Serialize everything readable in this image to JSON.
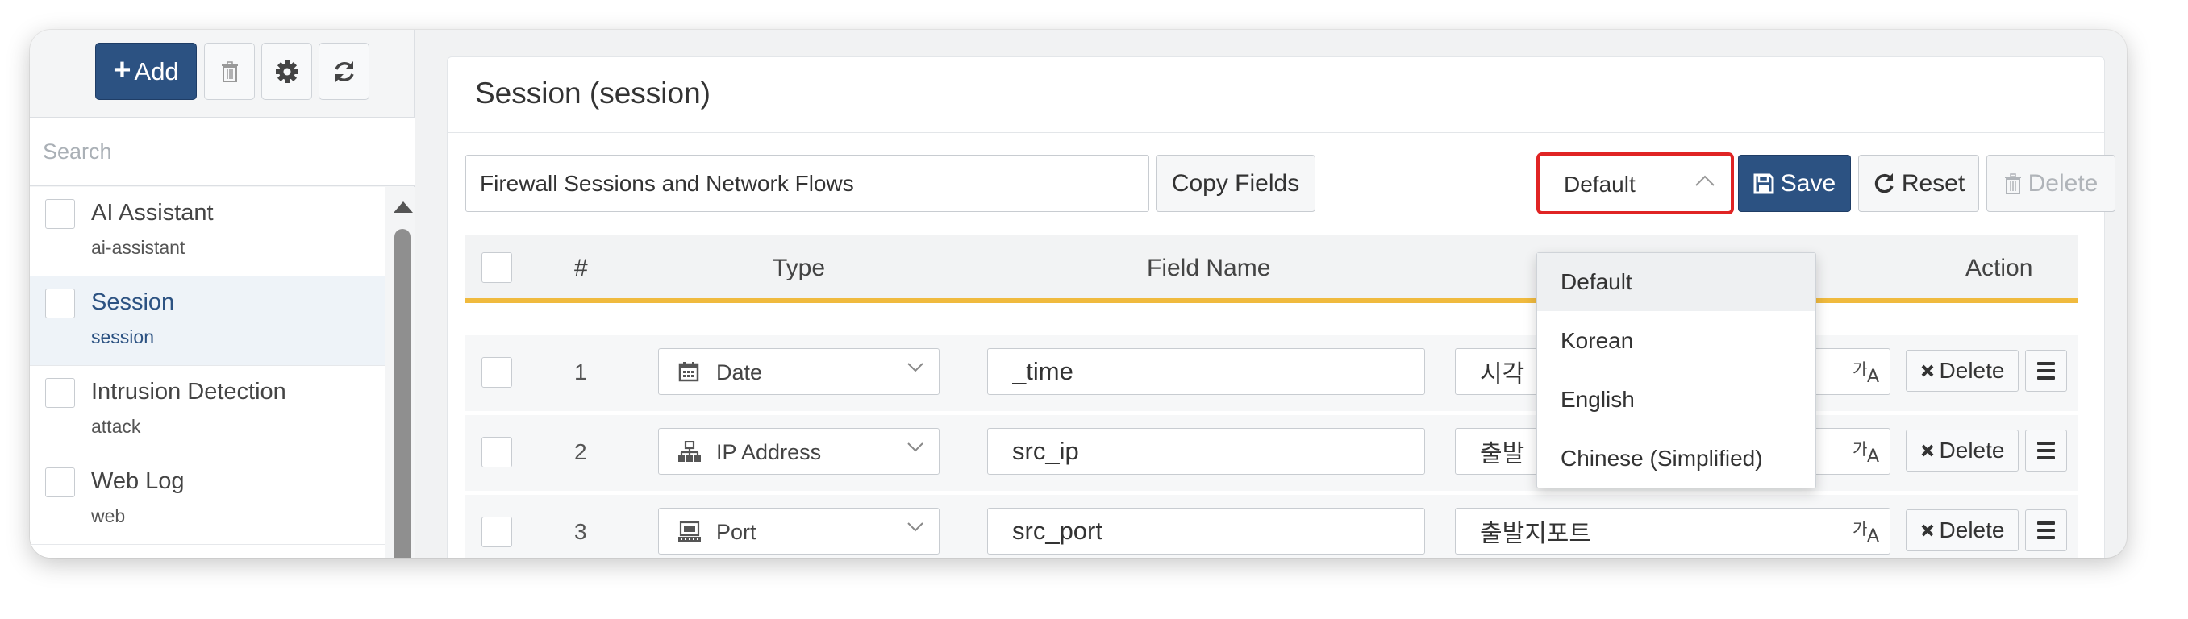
{
  "sidebar": {
    "add_label": "Add",
    "search_placeholder": "Search",
    "items": [
      {
        "name": "AI Assistant",
        "sub": "ai-assistant"
      },
      {
        "name": "Session",
        "sub": "session"
      },
      {
        "name": "Intrusion Detection",
        "sub": "attack"
      },
      {
        "name": "Web Log",
        "sub": "web"
      }
    ]
  },
  "main": {
    "title": "Session (session)",
    "description_value": "Firewall Sessions and Network Flows",
    "copy_fields_label": "Copy Fields",
    "language_selected": "Default",
    "save_label": "Save",
    "reset_label": "Reset",
    "delete_label": "Delete",
    "table": {
      "headers": {
        "num": "#",
        "type": "Type",
        "field_name": "Field Name",
        "action": "Action"
      },
      "rows": [
        {
          "num": "1",
          "type": "Date",
          "type_icon": "calendar-icon",
          "field": "_time",
          "label": "시각",
          "delete": "Delete"
        },
        {
          "num": "2",
          "type": "IP Address",
          "type_icon": "network-icon",
          "field": "src_ip",
          "label": "출발",
          "delete": "Delete"
        },
        {
          "num": "3",
          "type": "Port",
          "type_icon": "port-icon",
          "field": "src_port",
          "label": "출발지포트",
          "delete": "Delete"
        }
      ]
    },
    "language_options": [
      "Default",
      "Korean",
      "English",
      "Chinese (Simplified)"
    ],
    "translate_glyph": {
      "ga": "가",
      "a": "A"
    }
  },
  "colors": {
    "primary": "#2c5282",
    "highlight_border": "#e02424",
    "table_accent": "#f0ba3e"
  }
}
